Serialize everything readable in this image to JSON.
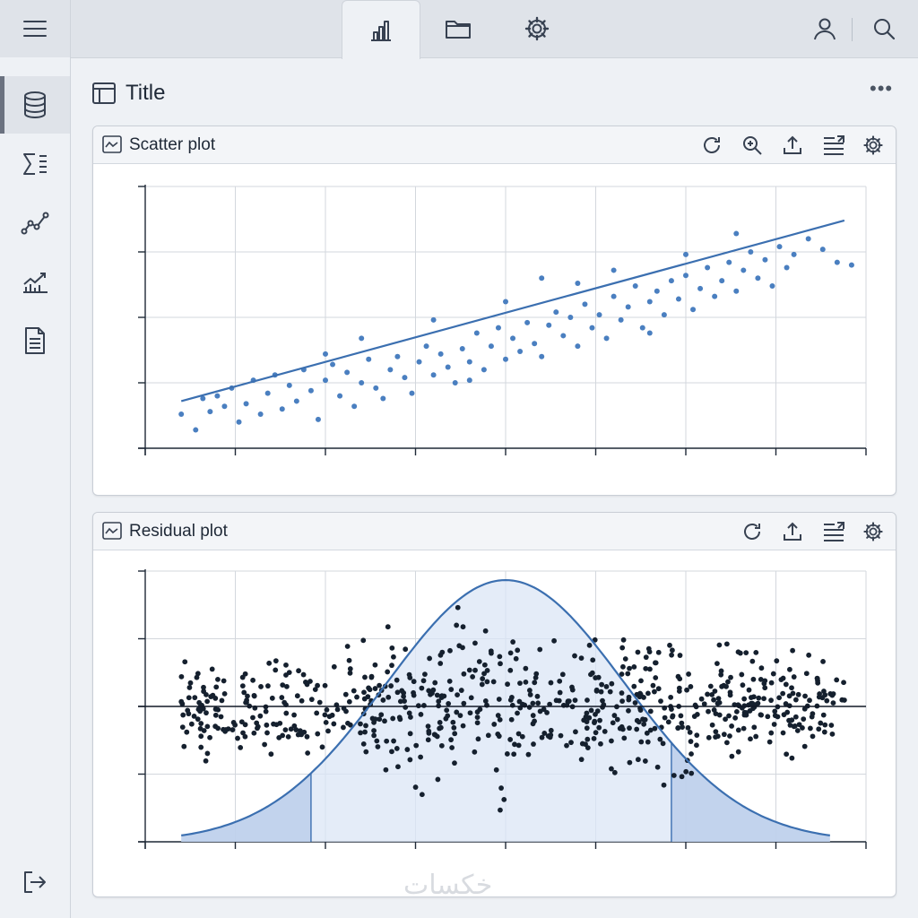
{
  "page": {
    "title": "Title",
    "watermark": "خكسات"
  },
  "scatter_panel": {
    "title": "Scatter plot"
  },
  "residual_panel": {
    "title": "Residual plot"
  },
  "colors": {
    "accent": "#3b6fb0",
    "point": "#4a7fc0",
    "residual": "#15202e",
    "curve_fill": "#dbe6f5"
  },
  "chart_data": [
    {
      "type": "scatter",
      "title": "Scatter plot",
      "xlim": [
        0,
        10
      ],
      "ylim": [
        0,
        10
      ],
      "points": [
        [
          0.5,
          1.3
        ],
        [
          0.7,
          0.7
        ],
        [
          0.8,
          1.9
        ],
        [
          0.9,
          1.4
        ],
        [
          1.0,
          2.0
        ],
        [
          1.1,
          1.6
        ],
        [
          1.2,
          2.3
        ],
        [
          1.3,
          1.0
        ],
        [
          1.4,
          1.7
        ],
        [
          1.5,
          2.6
        ],
        [
          1.6,
          1.3
        ],
        [
          1.7,
          2.1
        ],
        [
          1.8,
          2.8
        ],
        [
          1.9,
          1.5
        ],
        [
          2.0,
          2.4
        ],
        [
          2.1,
          1.8
        ],
        [
          2.2,
          3.0
        ],
        [
          2.3,
          2.2
        ],
        [
          2.4,
          1.1
        ],
        [
          2.5,
          2.6
        ],
        [
          2.6,
          3.2
        ],
        [
          2.7,
          2.0
        ],
        [
          2.8,
          2.9
        ],
        [
          2.9,
          1.6
        ],
        [
          3.0,
          2.5
        ],
        [
          3.1,
          3.4
        ],
        [
          3.2,
          2.3
        ],
        [
          3.3,
          1.9
        ],
        [
          3.4,
          3.0
        ],
        [
          3.5,
          3.5
        ],
        [
          3.6,
          2.7
        ],
        [
          3.7,
          2.1
        ],
        [
          3.8,
          3.3
        ],
        [
          3.9,
          3.9
        ],
        [
          4.0,
          2.8
        ],
        [
          4.1,
          3.6
        ],
        [
          4.2,
          3.1
        ],
        [
          4.3,
          2.5
        ],
        [
          4.4,
          3.8
        ],
        [
          4.5,
          3.3
        ],
        [
          4.6,
          4.4
        ],
        [
          4.7,
          3.0
        ],
        [
          4.8,
          3.9
        ],
        [
          4.9,
          4.6
        ],
        [
          5.0,
          3.4
        ],
        [
          5.1,
          4.2
        ],
        [
          5.2,
          3.7
        ],
        [
          5.3,
          4.8
        ],
        [
          5.4,
          4.0
        ],
        [
          5.5,
          3.5
        ],
        [
          5.6,
          4.7
        ],
        [
          5.7,
          5.2
        ],
        [
          5.8,
          4.3
        ],
        [
          5.9,
          5.0
        ],
        [
          6.0,
          3.9
        ],
        [
          6.1,
          5.5
        ],
        [
          6.2,
          4.6
        ],
        [
          6.3,
          5.1
        ],
        [
          6.4,
          4.2
        ],
        [
          6.5,
          5.8
        ],
        [
          6.6,
          4.9
        ],
        [
          6.7,
          5.4
        ],
        [
          6.8,
          6.2
        ],
        [
          6.9,
          4.6
        ],
        [
          7.0,
          5.6
        ],
        [
          7.1,
          6.0
        ],
        [
          7.2,
          5.1
        ],
        [
          7.3,
          6.4
        ],
        [
          7.4,
          5.7
        ],
        [
          7.5,
          6.6
        ],
        [
          7.6,
          5.3
        ],
        [
          7.7,
          6.1
        ],
        [
          7.8,
          6.9
        ],
        [
          7.9,
          5.8
        ],
        [
          8.0,
          6.4
        ],
        [
          8.1,
          7.1
        ],
        [
          8.2,
          6.0
        ],
        [
          8.3,
          6.8
        ],
        [
          8.4,
          7.5
        ],
        [
          8.5,
          6.5
        ],
        [
          8.6,
          7.2
        ],
        [
          8.7,
          6.2
        ],
        [
          8.8,
          7.7
        ],
        [
          8.9,
          6.9
        ],
        [
          9.0,
          7.4
        ],
        [
          9.2,
          8.0
        ],
        [
          9.4,
          7.6
        ],
        [
          9.6,
          7.1
        ],
        [
          9.8,
          7.0
        ],
        [
          3.0,
          4.2
        ],
        [
          4.0,
          4.9
        ],
        [
          5.0,
          5.6
        ],
        [
          6.0,
          6.3
        ],
        [
          7.0,
          4.4
        ],
        [
          2.5,
          3.6
        ],
        [
          5.5,
          6.5
        ],
        [
          6.5,
          6.8
        ],
        [
          7.5,
          7.4
        ],
        [
          8.2,
          8.2
        ],
        [
          4.5,
          2.6
        ]
      ],
      "fit_line": [
        [
          0.5,
          1.8
        ],
        [
          9.7,
          8.7
        ]
      ]
    },
    {
      "type": "scatter",
      "title": "Residual plot",
      "xlim": [
        0,
        10
      ],
      "ylim": [
        -3,
        3
      ],
      "normal_curve": {
        "mean": 5,
        "sd": 1.65,
        "peak": 2.8,
        "base": -3,
        "shade_left": 2.3,
        "shade_right": 7.3
      },
      "zero_line": 0
    }
  ]
}
